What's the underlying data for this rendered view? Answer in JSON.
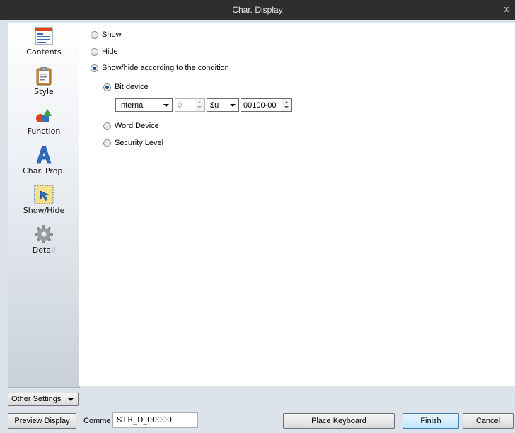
{
  "window": {
    "title": "Char. Display",
    "close_glyph": "x"
  },
  "sidebar": {
    "items": [
      {
        "label": "Contents",
        "icon": "contents-icon",
        "selected": false
      },
      {
        "label": "Style",
        "icon": "clipboard-icon",
        "selected": false
      },
      {
        "label": "Function",
        "icon": "shapes-icon",
        "selected": false
      },
      {
        "label": "Char. Prop.",
        "icon": "letter-a-icon",
        "selected": false
      },
      {
        "label": "Show/Hide",
        "icon": "cursor-frame-icon",
        "selected": true
      },
      {
        "label": "Detail",
        "icon": "gear-icon",
        "selected": false
      }
    ],
    "other_settings_label": "Other Settings"
  },
  "display": {
    "show_label": "Show",
    "hide_label": "Hide",
    "condition_label": "Show/hide according to the condition",
    "selected": "condition"
  },
  "condition": {
    "bit_device_label": "Bit device",
    "word_device_label": "Word Device",
    "security_level_label": "Security Level",
    "selected": "bit_device",
    "device_type": "Internal",
    "station_number": "0",
    "memory_type": "$u",
    "address": "00100-00"
  },
  "footer": {
    "preview_label": "Preview Display",
    "comment_label": "Comme",
    "comment_value": "STR_D_00000",
    "place_keyboard_label": "Place Keyboard",
    "finish_label": "Finish",
    "cancel_label": "Cancel"
  },
  "colors": {
    "titlebar": "#2e2e2e",
    "frame": "#dde3ea",
    "accent": "#1c4b9a"
  }
}
